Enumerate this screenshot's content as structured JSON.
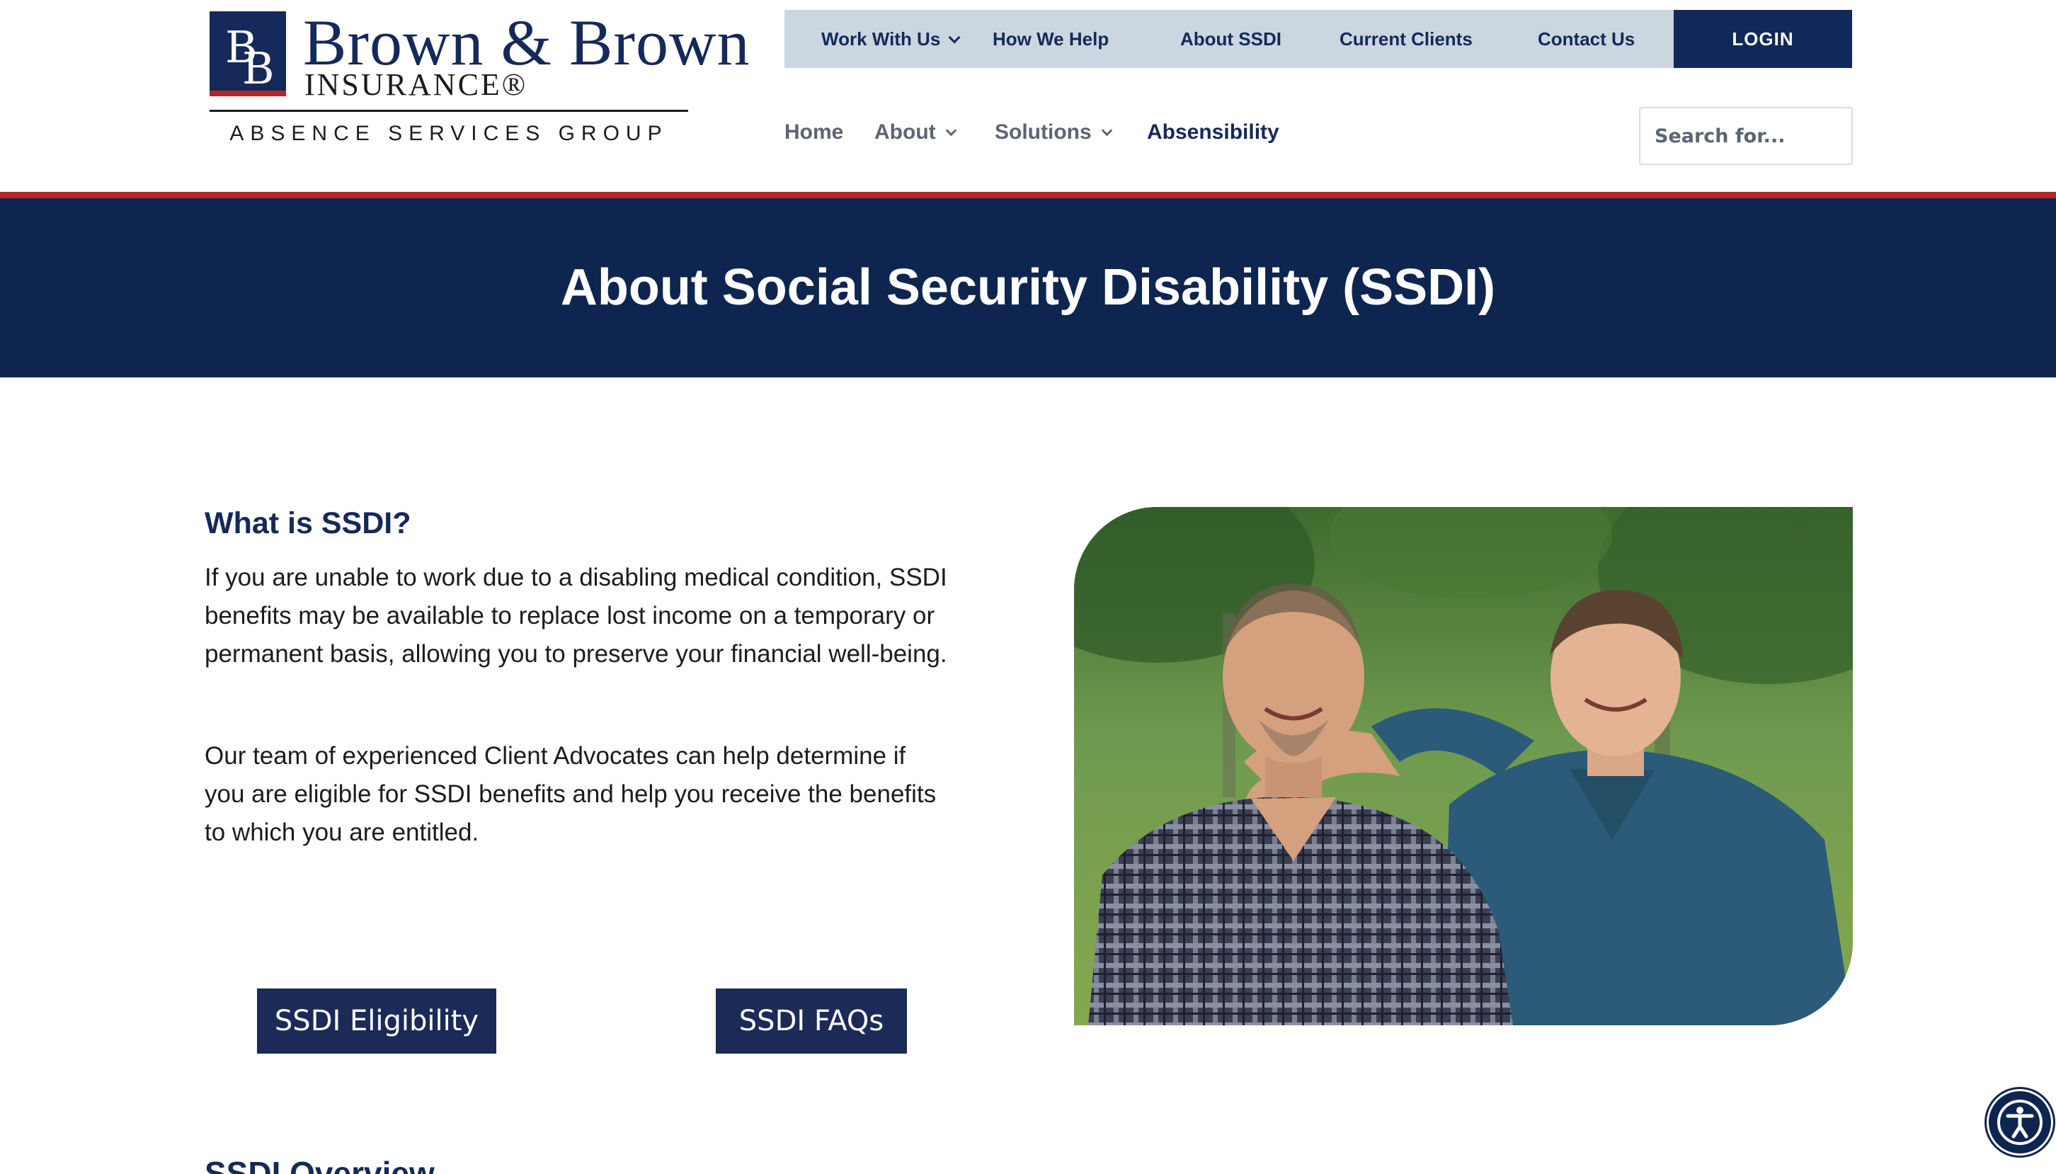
{
  "logo": {
    "mark_letters": [
      "B",
      "B"
    ],
    "name": "Brown & Brown",
    "insurance": "INSURANCE®",
    "tagline": "ABSENCE SERVICES GROUP"
  },
  "topbar": {
    "items": [
      {
        "label": "Work With Us",
        "has_dropdown": true
      },
      {
        "label": "How We Help"
      },
      {
        "label": "About SSDI"
      },
      {
        "label": "Current Clients"
      },
      {
        "label": "Contact Us"
      }
    ],
    "login": "LOGIN"
  },
  "mainnav": {
    "items": [
      {
        "label": "Home"
      },
      {
        "label": "About",
        "has_dropdown": true
      },
      {
        "label": "Solutions",
        "has_dropdown": true
      },
      {
        "label": "Absensibility",
        "active": true
      }
    ]
  },
  "search": {
    "placeholder": "Search for..."
  },
  "hero": {
    "title": "About Social Security Disability (SSDI)"
  },
  "content": {
    "heading": "What is SSDI?",
    "paragraphs": [
      "If you are unable to work due to a disabling medical condition, SSDI benefits may be available to replace lost income on a temporary or permanent basis, allowing you to preserve your financial well-being.",
      "Our team of experienced Client Advocates can help determine if you are eligible for SSDI benefits and help you receive the benefits to which you are entitled."
    ],
    "buttons": {
      "eligibility": "SSDI Eligibility",
      "faqs": "SSDI FAQs"
    },
    "next_heading": "SSDI Overview"
  },
  "icons": {
    "accessibility": "accessibility-icon"
  },
  "colors": {
    "navy": "#0e2550",
    "red_accent": "#b3242c",
    "topbar_bg": "#ccd6e0",
    "button": "#1b2a57"
  }
}
